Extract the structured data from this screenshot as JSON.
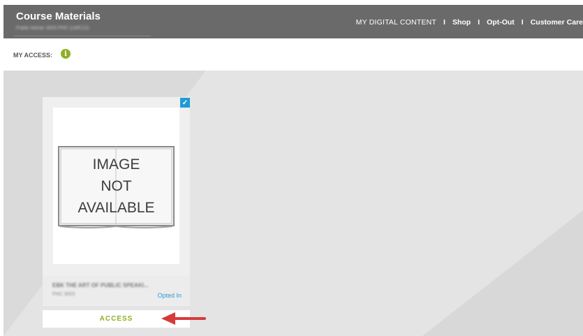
{
  "header": {
    "title": "Course Materials",
    "subtitle": "Public Adrian 3003 PHC (LWC12)",
    "nav": [
      {
        "label": "MY DIGITAL CONTENT"
      },
      {
        "label": "Shop"
      },
      {
        "label": "Opt-Out"
      },
      {
        "label": "Customer Care"
      }
    ],
    "separator": "I"
  },
  "access": {
    "label": "MY ACCESS:",
    "info_icon": "i"
  },
  "card": {
    "checkbox_mark": "✓",
    "image_placeholder": [
      "IMAGE",
      "NOT",
      "AVAILABLE"
    ],
    "title": "EBK THE ART OF PUBLIC SPEAKI...",
    "code": "PHC 3003",
    "status": "Opted In",
    "access_button": "ACCESS"
  },
  "colors": {
    "header_bg": "#6a6a6a",
    "accent_green": "#8fb027",
    "accent_blue": "#1f9ad6",
    "arrow_red": "#d63a3a"
  }
}
